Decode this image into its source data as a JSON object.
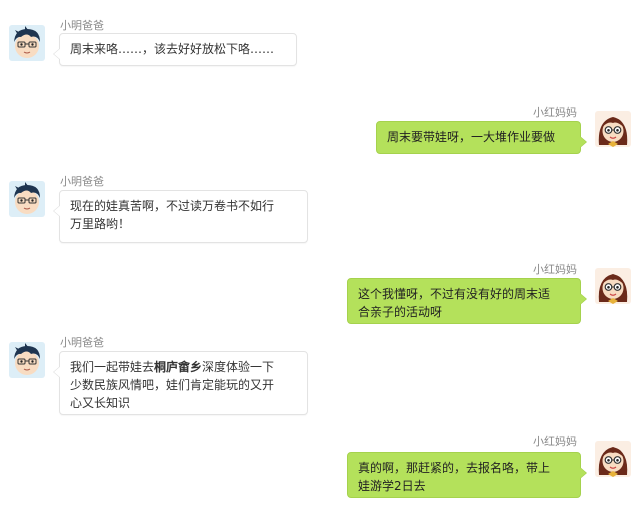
{
  "chat": {
    "dad_name": "小明爸爸",
    "mom_name": "小红妈妈",
    "messages": [
      {
        "sender": "小明爸爸",
        "text": "周末来咯……，该去好好放松下咯……"
      },
      {
        "sender": "小红妈妈",
        "text": "周末要带娃呀，一大堆作业要做"
      },
      {
        "sender": "小明爸爸",
        "line1": "现在的娃真苦啊，不过读万卷书不如行",
        "line2": "万里路哟！"
      },
      {
        "sender": "小红妈妈",
        "line1": "这个我懂呀，不过有没有好的周末适",
        "line2": "合亲子的活动呀"
      },
      {
        "sender": "小明爸爸",
        "pre": "我们一起带娃去",
        "highlight": "桐庐畲乡",
        "post": "深度体验一下",
        "line2": "少数民族风情吧，娃们肯定能玩的又开",
        "line3": "心又长知识"
      },
      {
        "sender": "小红妈妈",
        "line1": "真的啊，那赶紧的，去报名咯，带上",
        "line2": "娃游学2日去"
      }
    ]
  },
  "colors": {
    "right_bubble": "#b4e15b",
    "left_bubble": "#ffffff",
    "name_text": "#8a8a8a"
  },
  "icons": {
    "dad_avatar": "boy-avatar-icon",
    "mom_avatar": "girl-avatar-icon"
  }
}
